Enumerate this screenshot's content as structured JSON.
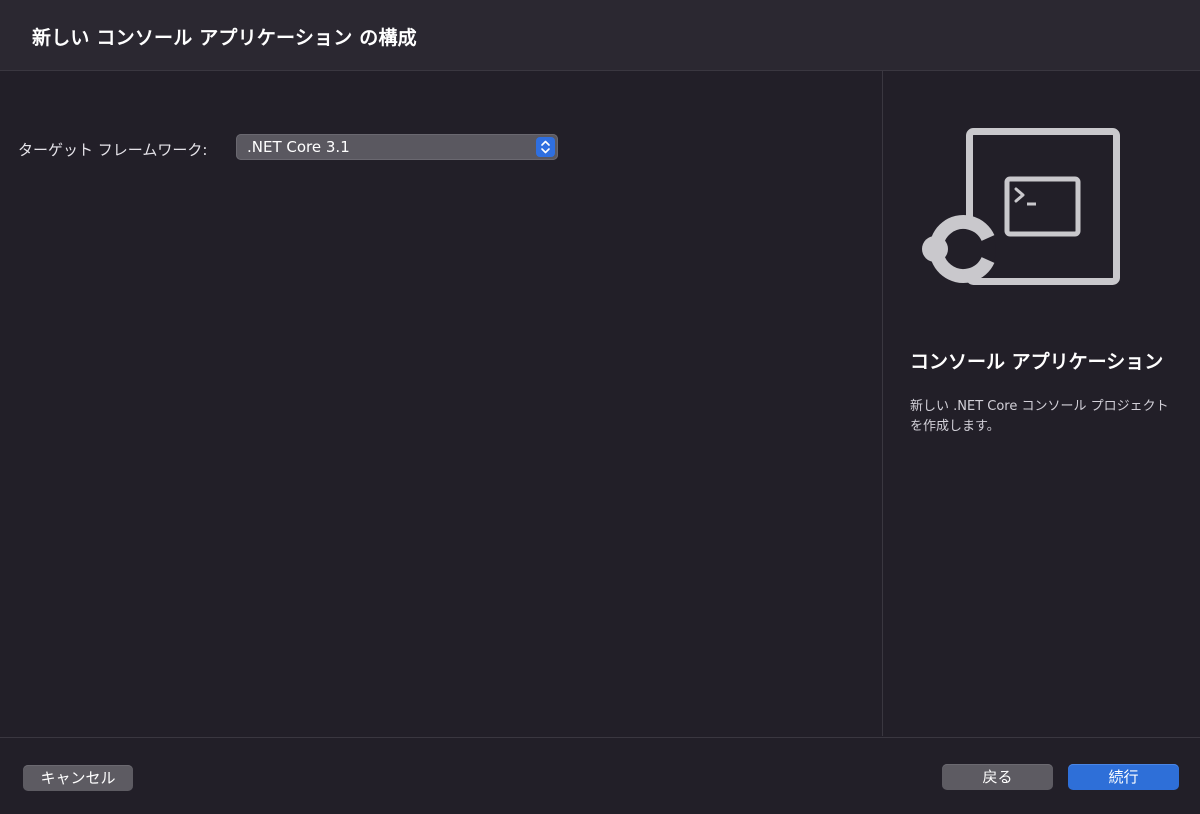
{
  "dialog": {
    "title": "新しい コンソール アプリケーション の構成"
  },
  "form": {
    "target_framework_label": "ターゲット フレームワーク:",
    "target_framework_value": ".NET Core 3.1"
  },
  "template": {
    "icon": "console-app-icon",
    "title": "コンソール アプリケーション",
    "description": "新しい .NET Core コンソール プロジェクトを作成します。"
  },
  "footer": {
    "cancel_label": "キャンセル",
    "back_label": "戻る",
    "continue_label": "続行"
  },
  "colors": {
    "accent": "#2e6fd8",
    "background": "#221f28",
    "header_background": "#2b2831"
  }
}
